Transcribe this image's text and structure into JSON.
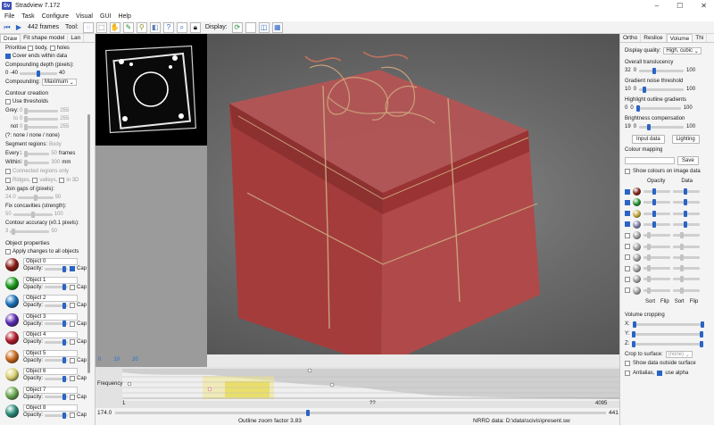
{
  "window": {
    "title": "Stradview 7.172",
    "logo": "Sv",
    "controls": [
      "–",
      "☐",
      "✕"
    ]
  },
  "menu": [
    "File",
    "Task",
    "Configure",
    "Visual",
    "GUI",
    "Help"
  ],
  "toolbar": {
    "frames_label": "442 frames",
    "tool_label": "Tool:",
    "display_label": "Display:"
  },
  "left": {
    "tabs": [
      "Draw",
      "Fit shape model",
      "Lan"
    ],
    "prioritise": {
      "label": "Prioritise",
      "body": "body,",
      "holes": "holes"
    },
    "cover_ends": "Cover ends within data",
    "compounding_depth_label": "Compounding depth (pixels):",
    "depth_min": "0",
    "depth_low": "-40",
    "depth_high": "40",
    "compounding_label": "Compounding:",
    "compounding_value": "Maximum",
    "contour_creation": "Contour creation",
    "use_thresholds": "Use thresholds",
    "grey_label": "Grey:",
    "grey_val": "0",
    "grey_max": "255",
    "to_label": "to",
    "to_val": "0",
    "to_max": "255",
    "not_label": "not",
    "not_val": "0",
    "not_max": "255",
    "threshold_summary": "(?:  none / none / none)",
    "segment_regions": "Segment regions:",
    "segment_value": "Body",
    "every_label": "Every",
    "every_val": "1",
    "every_max": "50",
    "every_unit": "frames",
    "within_label": "Within",
    "within_val": "0",
    "within_max": "300",
    "within_unit": "mm",
    "connected_regions": "Connected regions only",
    "ridges": "Ridges,",
    "valleys": "valleys,",
    "in3d": "in 3D",
    "join_gaps": "Join gaps of (pixels):",
    "join_val": "24.0",
    "join_max": "50",
    "fix_concavities": "Fix concavities (strength):",
    "fix_val": "50",
    "fix_max": "100",
    "contour_accuracy": "Contour accuracy (x0.1 pixels):",
    "acc_val": "3",
    "acc_max": "50",
    "object_properties": "Object properties",
    "apply_all": "Apply changes to all objects",
    "opacity_label": "Opacity:",
    "cap_label": "Cap",
    "objects": [
      {
        "name": "Object 0",
        "color": "#8a1c12"
      },
      {
        "name": "Object 1",
        "color": "#1c9a1c"
      },
      {
        "name": "Object 2",
        "color": "#1a6fb8"
      },
      {
        "name": "Object 3",
        "color": "#5a2ab0"
      },
      {
        "name": "Object 4",
        "color": "#b01a2a"
      },
      {
        "name": "Object 5",
        "color": "#c8681c"
      },
      {
        "name": "Object 6",
        "color": "#d8d070"
      },
      {
        "name": "Object 7",
        "color": "#6aa850"
      },
      {
        "name": "Object 8",
        "color": "#2a8a7a"
      }
    ]
  },
  "histogram": {
    "label": "Frequency",
    "scale_ticks": [
      "0",
      "10",
      "20"
    ],
    "left_val": "1",
    "mid_val": "??",
    "right_val": "4095"
  },
  "status": {
    "left_value": "174.0",
    "zoom_text": "Outline zoom factor 3.83",
    "right_value": "441",
    "nrrd_text": "NRRD data: D:\\data\\scivis\\present.sw"
  },
  "right": {
    "tabs": [
      "Ortho",
      "Reslice",
      "Volume",
      "Thi"
    ],
    "display_quality_label": "Display quality:",
    "display_quality": "High, cubic",
    "overall_translucency": "Overall translucency",
    "trans_val": "32",
    "trans_min": "0",
    "trans_max": "100",
    "gradient_noise": "Gradient noise threshold",
    "noise_val": "10",
    "noise_min": "0",
    "noise_max": "100",
    "highlight_outline": "Highlight outline gradients",
    "high_val": "0",
    "high_min": "0",
    "high_max": "100",
    "brightness": "Brightness compensation",
    "bright_val": "19",
    "bright_min": "0",
    "bright_max": "100",
    "input_data_btn": "Input data",
    "lighting_btn": "Lighting",
    "colour_mapping": "Colour mapping",
    "save_btn": "Save",
    "show_colours": "Show colours on image data",
    "opacity_col": "Opacity",
    "data_col": "Data",
    "map_rows": [
      {
        "color": "#7a1e14",
        "on": true
      },
      {
        "color": "#1e8a2a",
        "on": true
      },
      {
        "color": "#bfa23a",
        "on": true
      },
      {
        "color": "#7a7aa0",
        "on": true
      },
      {
        "color": "#9a9a9a",
        "on": false
      },
      {
        "color": "#9a9a9a",
        "on": false
      },
      {
        "color": "#9a9a9a",
        "on": false
      },
      {
        "color": "#9a9a9a",
        "on": false
      },
      {
        "color": "#9a9a9a",
        "on": false
      },
      {
        "color": "#9a9a9a",
        "on": false
      }
    ],
    "sort_btn": "Sort",
    "flip_btn": "Flip",
    "volume_cropping": "Volume cropping",
    "x_label": "X:",
    "y_label": "Y:",
    "z_label": "Z:",
    "crop_surface_label": "Crop to surface:",
    "crop_surface_value": "(none)",
    "show_outside": "Show data outside surface",
    "antialias": "Antialias,",
    "use_alpha": "use alpha"
  }
}
